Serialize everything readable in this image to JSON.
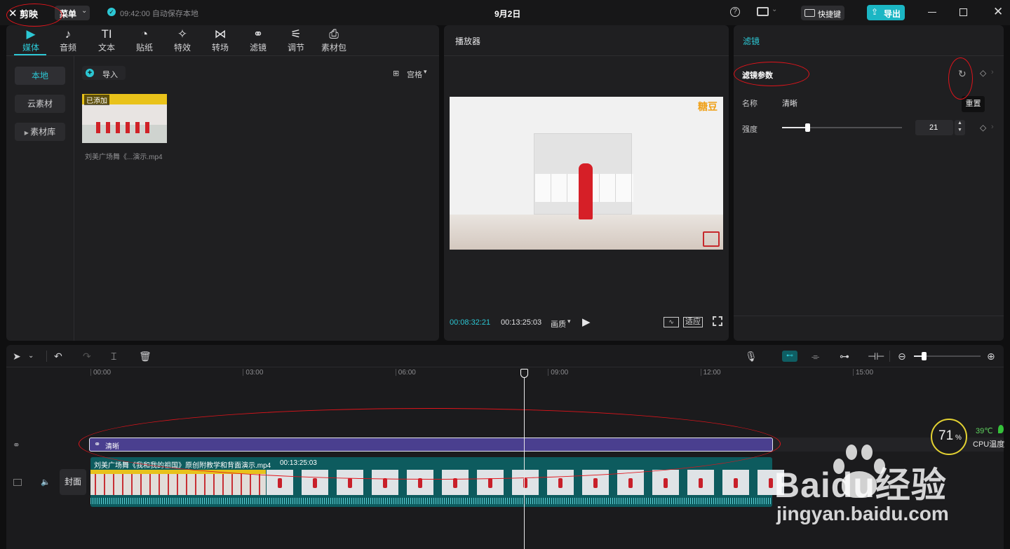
{
  "app": {
    "logo_text": "剪映",
    "menu_label": "菜单",
    "autosave": "09:42:00 自动保存本地",
    "project_title": "9月2日",
    "shortcut_label": "快捷键",
    "export_label": "导出"
  },
  "media_tabs": [
    {
      "label": "媒体",
      "icon": "media-icon",
      "glyph": "▶"
    },
    {
      "label": "音频",
      "icon": "audio-icon",
      "glyph": "♪"
    },
    {
      "label": "文本",
      "icon": "text-icon",
      "glyph": "TI"
    },
    {
      "label": "贴纸",
      "icon": "sticker-icon",
      "glyph": "◔"
    },
    {
      "label": "特效",
      "icon": "effects-icon",
      "glyph": "✧"
    },
    {
      "label": "转场",
      "icon": "transition-icon",
      "glyph": "⋈"
    },
    {
      "label": "滤镜",
      "icon": "filter-icon",
      "glyph": "⚭"
    },
    {
      "label": "调节",
      "icon": "adjust-icon",
      "glyph": "⚟"
    },
    {
      "label": "素材包",
      "icon": "package-icon",
      "glyph": "⎙"
    }
  ],
  "media_sidebar": {
    "local": "本地",
    "cloud": "云素材",
    "library": "素材库"
  },
  "media": {
    "import_label": "导入",
    "view_label": "宫格",
    "clip_added_badge": "已添加",
    "clip_filename": "刘美广场舞《...演示.mp4"
  },
  "player": {
    "title": "播放器",
    "current_time": "00:08:32:21",
    "total_time": "00:13:25:03",
    "quality_label": "画质",
    "fit_label": "适应",
    "watermark": "糖豆"
  },
  "inspector": {
    "tab_label": "滤镜",
    "section_title": "滤镜参数",
    "reset_tooltip": "重置",
    "name_label": "名称",
    "name_value": "清晰",
    "strength_label": "强度",
    "strength_value": "21",
    "strength_fraction": 0.21
  },
  "timeline": {
    "ruler": [
      "00:00",
      "03:00",
      "06:00",
      "09:00",
      "12:00",
      "15:00"
    ],
    "filter_clip_label": "清晰",
    "video_clip_name": "刘美广场舞《我和我的祖国》原创附教学和背面演示.mp4",
    "video_clip_duration": "00:13:25:03",
    "cover_label": "封面"
  },
  "cpu": {
    "percent": "71",
    "percent_sign": "%",
    "temp": "39℃",
    "label": "CPU温度"
  },
  "watermark": {
    "brand": "Baidu经验",
    "url": "jingyan.baidu.com"
  },
  "colors": {
    "accent": "#2cc7d4",
    "filter_track": "#4a3f8f",
    "video_track": "#0d5b5e",
    "annotation": "#e0141b"
  }
}
